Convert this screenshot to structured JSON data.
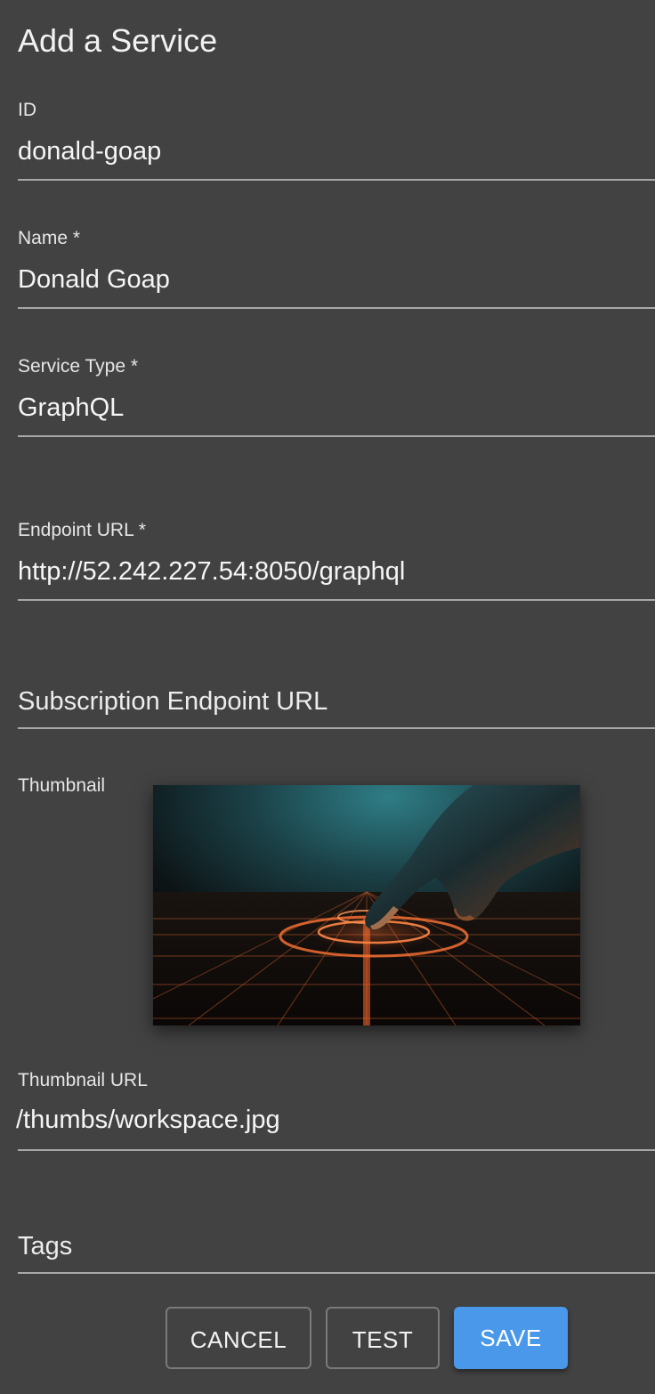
{
  "dialog": {
    "title": "Add a Service"
  },
  "fields": {
    "id": {
      "label": "ID",
      "value": "donald-goap"
    },
    "name": {
      "label": "Name *",
      "value": "Donald Goap"
    },
    "service_type": {
      "label": "Service Type *",
      "value": "GraphQL"
    },
    "endpoint_url": {
      "label": "Endpoint URL *",
      "value": "http://52.242.227.54:8050/graphql"
    },
    "subscription_endpoint_url": {
      "placeholder": "Subscription Endpoint URL",
      "value": ""
    },
    "thumbnail": {
      "label": "Thumbnail",
      "image": "finger-touching-glowing-grid-thumbnail"
    },
    "thumbnail_url": {
      "label": "Thumbnail URL",
      "value": "/thumbs/workspace.jpg"
    },
    "tags": {
      "placeholder": "Tags",
      "value": ""
    }
  },
  "actions": {
    "cancel_label": "CANCEL",
    "test_label": "TEST",
    "save_label": "SAVE"
  },
  "colors": {
    "background": "#424242",
    "primary": "#4a98ea",
    "underline": "#a8a8a8"
  }
}
